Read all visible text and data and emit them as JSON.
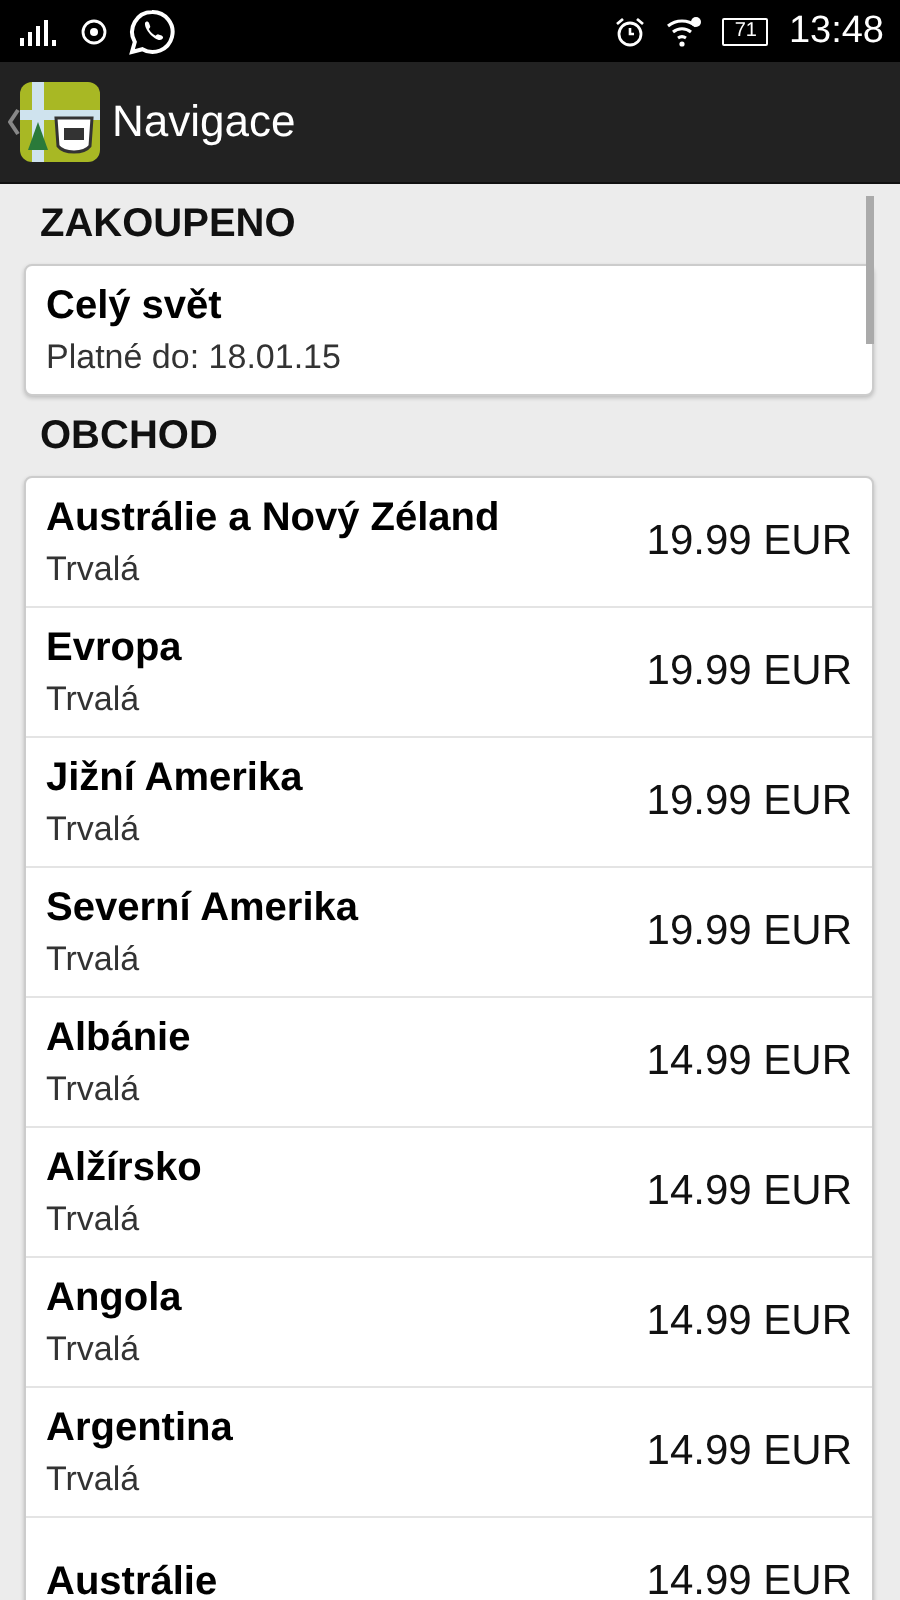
{
  "status_bar": {
    "battery": "71",
    "time": "13:48"
  },
  "action_bar": {
    "title": "Navigace"
  },
  "sections": [
    {
      "title": "ZAKOUPENO",
      "items": [
        {
          "name": "Celý svět",
          "subtitle": "Platné do: 18.01.15"
        }
      ]
    },
    {
      "title": "OBCHOD",
      "items": [
        {
          "name": "Austrálie a Nový Zéland",
          "subtitle": "Trvalá",
          "price": "19.99 EUR"
        },
        {
          "name": "Evropa",
          "subtitle": "Trvalá",
          "price": "19.99 EUR"
        },
        {
          "name": "Jižní Amerika",
          "subtitle": "Trvalá",
          "price": "19.99 EUR"
        },
        {
          "name": "Severní Amerika",
          "subtitle": "Trvalá",
          "price": "19.99 EUR"
        },
        {
          "name": "Albánie",
          "subtitle": "Trvalá",
          "price": "14.99 EUR"
        },
        {
          "name": "Alžírsko",
          "subtitle": "Trvalá",
          "price": "14.99 EUR"
        },
        {
          "name": "Angola",
          "subtitle": "Trvalá",
          "price": "14.99 EUR"
        },
        {
          "name": "Argentina",
          "subtitle": "Trvalá",
          "price": "14.99 EUR"
        },
        {
          "name": "Austrálie",
          "price": "14.99 EUR"
        }
      ]
    }
  ]
}
